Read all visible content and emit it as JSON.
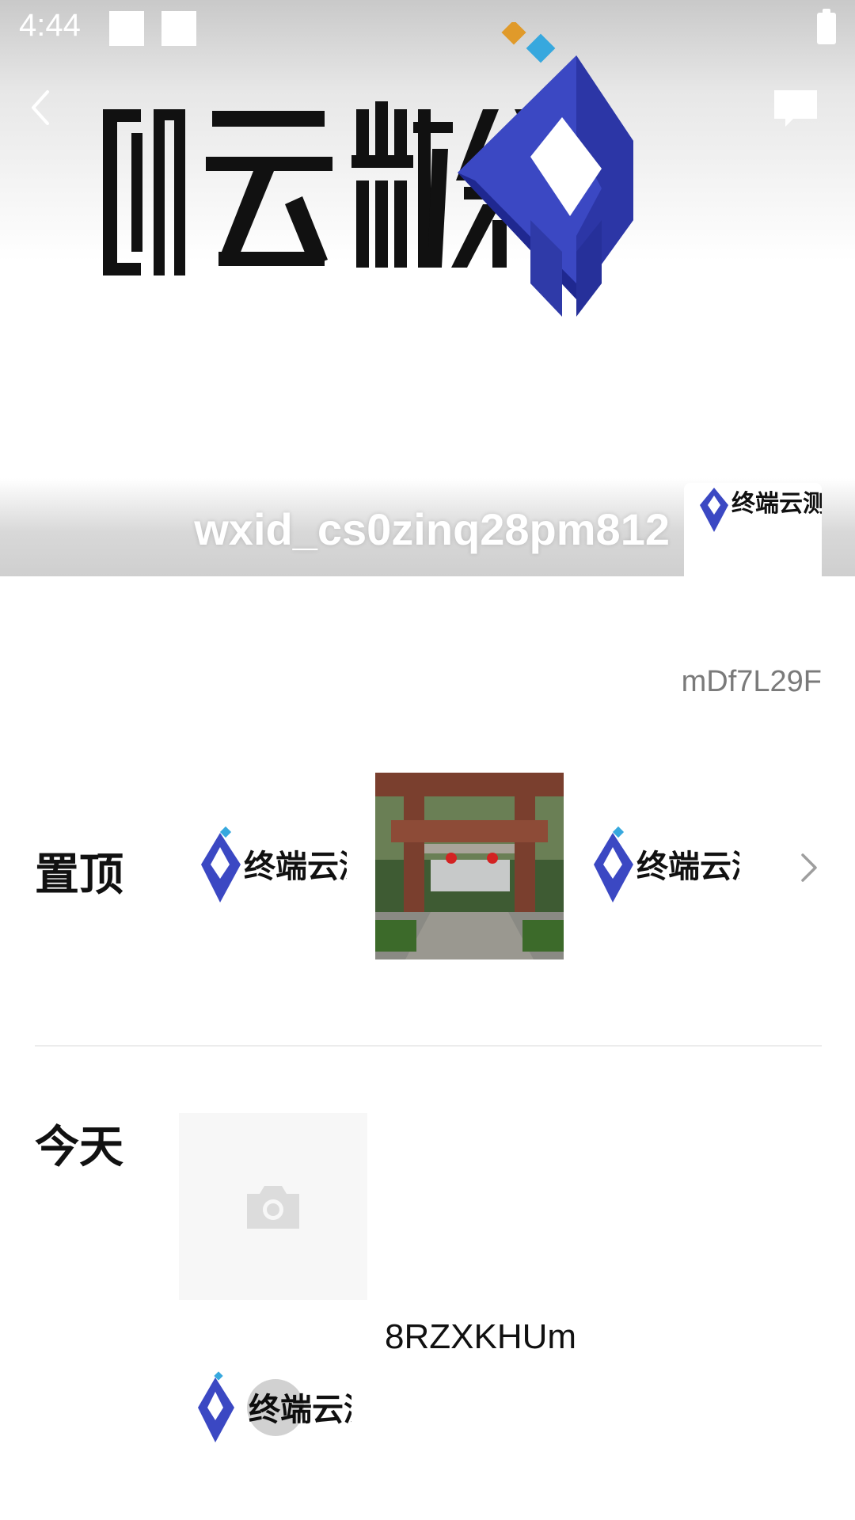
{
  "status_bar": {
    "time": "4:44"
  },
  "header": {
    "cover_logo_text": "终端云测",
    "username": "wxid_cs0zinq28pm812",
    "avatar_logo_text": "终端云测",
    "back_icon": "chevron-left-icon",
    "chat_icon": "chat-bubble-icon"
  },
  "profile": {
    "signature": "mDf7L29F"
  },
  "pinned": {
    "label": "置顶",
    "items": [
      {
        "type": "logo",
        "text": "终端云测"
      },
      {
        "type": "photo"
      },
      {
        "type": "logo",
        "text": "终端云测"
      }
    ]
  },
  "today": {
    "label": "今天",
    "post_text": "8RZXKHUm",
    "video_logo_text": "终端云测"
  },
  "colors": {
    "logo_blue": "#3b48c3",
    "logo_dark_blue": "#2c36a6",
    "logo_orange": "#e09a2a",
    "logo_cyan": "#37a8de",
    "divider": "#ececec",
    "placeholder": "#f7f7f7"
  }
}
